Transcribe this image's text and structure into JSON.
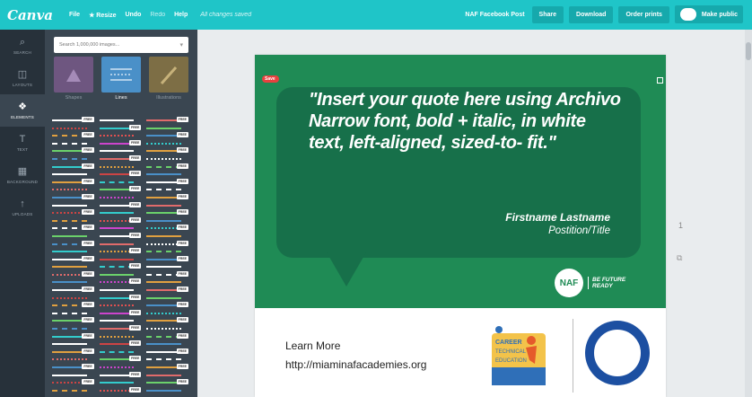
{
  "app": {
    "logo": "Canva",
    "menu": [
      "File",
      "Resize",
      "Undo",
      "Redo",
      "Help"
    ],
    "resize_icon": "star-icon",
    "status": "All changes saved",
    "design_name": "NAF Facebook Post",
    "buttons": {
      "share": "Share",
      "download": "Download",
      "order": "Order prints",
      "make_public": "Make public"
    },
    "accent": "#1fc5c8"
  },
  "rail": [
    {
      "label": "SEARCH",
      "icon": "search-icon",
      "glyph": "⌕"
    },
    {
      "label": "LAYOUTS",
      "icon": "layouts-icon",
      "glyph": "◫"
    },
    {
      "label": "ELEMENTS",
      "icon": "elements-icon",
      "glyph": "❖",
      "active": true
    },
    {
      "label": "TEXT",
      "icon": "text-icon",
      "glyph": "T"
    },
    {
      "label": "BACKGROUND",
      "icon": "background-icon",
      "glyph": "▦"
    },
    {
      "label": "UPLOADS",
      "icon": "upload-icon",
      "glyph": "↑"
    }
  ],
  "panel": {
    "search_placeholder": "Search 1,000,000 images...",
    "categories": [
      {
        "label": "Shapes",
        "color": "#7a5c8a"
      },
      {
        "label": "Lines",
        "color": "#4a90c8",
        "active": true
      },
      {
        "label": "Illustrations",
        "color": "#8a7a4a"
      }
    ],
    "free_badge": "FREE"
  },
  "canvas": {
    "save_label": "Save",
    "quote": "\"Insert your quote here using Archivo Narrow font, bold + italic, in white text, left-aligned, sized-to- fit.\"",
    "author_name": "Firstname Lastname",
    "author_title": "Postition/Title",
    "naf_logo": "NAF",
    "naf_tagline_1": "BE FUTURE",
    "naf_tagline_2": "READY",
    "learn_more": "Learn More",
    "url": "http://miaminafacademies.org",
    "cte_line1": "CAREER",
    "cte_line2": "TECHNICAL",
    "cte_line3": "EDUCATION",
    "page_number": "1",
    "green": "#1f8b55",
    "bubble": "#17704a"
  }
}
